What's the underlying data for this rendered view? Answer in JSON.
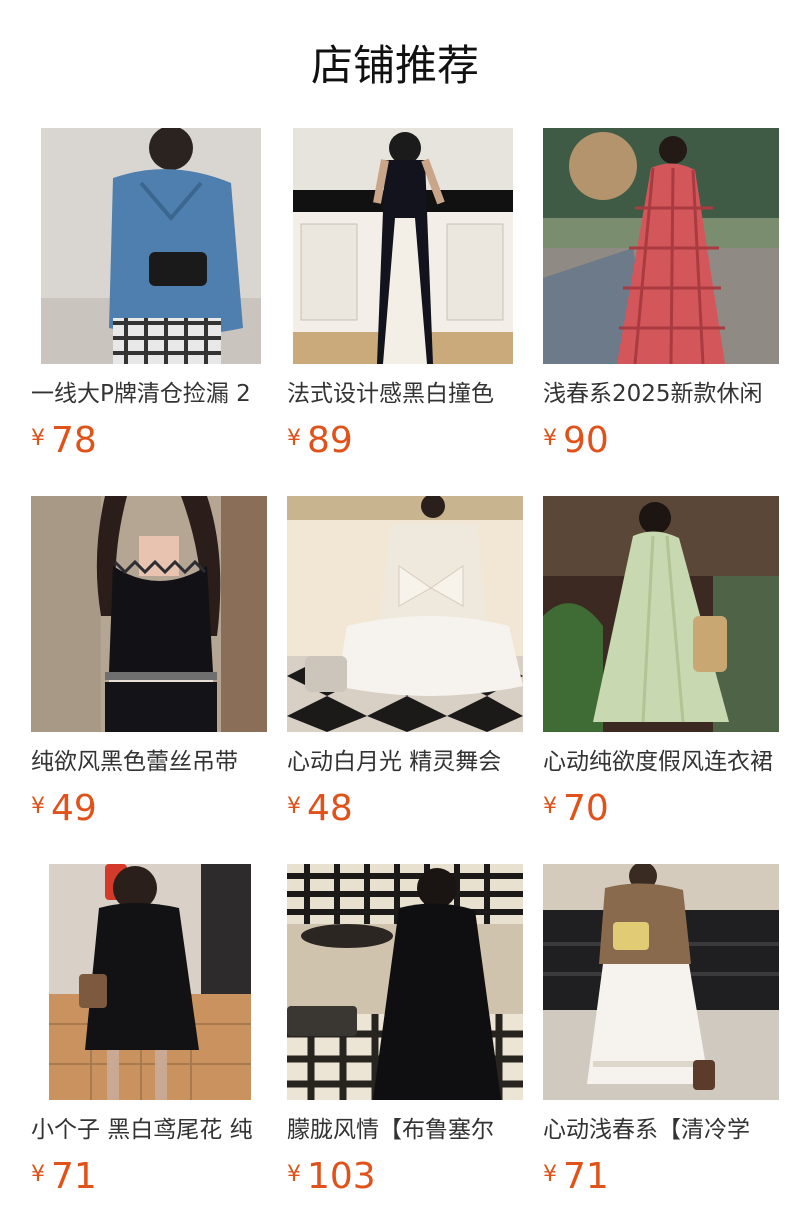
{
  "header": {
    "title": "店铺推荐"
  },
  "currency_symbol": "¥",
  "products": [
    {
      "name": "一线大P牌清仓捡漏 2",
      "price": "78",
      "image": "denim-jacket-outfit"
    },
    {
      "name": "法式设计感黑白撞色",
      "price": "89",
      "image": "black-white-maxi-dress"
    },
    {
      "name": "浅春系2025新款休闲",
      "price": "90",
      "image": "red-plaid-slip-dress"
    },
    {
      "name": "纯欲风黑色蕾丝吊带",
      "price": "49",
      "image": "black-lace-camisole"
    },
    {
      "name": "心动白月光 精灵舞会",
      "price": "48",
      "image": "white-bow-tube-dress"
    },
    {
      "name": "心动纯欲度假风连衣裙",
      "price": "70",
      "image": "mint-green-maxi-dress"
    },
    {
      "name": "小个子 黑白鸢尾花 纯",
      "price": "71",
      "image": "black-mini-dress"
    },
    {
      "name": "朦胧风情【布鲁塞尔",
      "price": "103",
      "image": "black-lace-dress"
    },
    {
      "name": "心动浅春系【清冷学",
      "price": "71",
      "image": "white-eyelet-skirt"
    }
  ],
  "colors": {
    "price": "#e0521a",
    "title": "#111111",
    "name": "#333333"
  }
}
